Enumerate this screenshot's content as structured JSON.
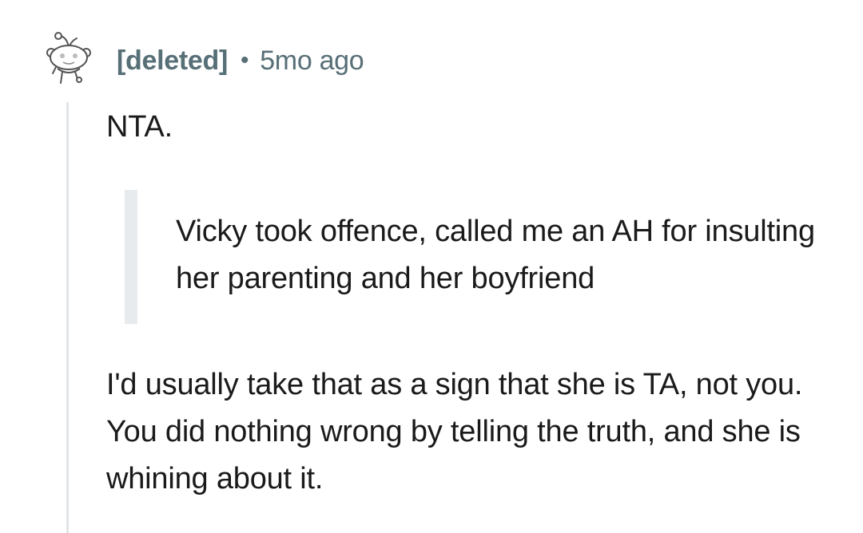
{
  "comment": {
    "author": "[deleted]",
    "separator": "•",
    "timestamp": "5mo ago",
    "avatar_icon": "snoo-avatar-icon",
    "paragraphs": {
      "first": "NTA.",
      "quote": "Vicky took offence, called me an AH for insulting her parenting and her boyfriend",
      "last": "I'd usually take that as a sign that she is TA, not you. You did nothing wrong by telling the truth, and she is whining about it."
    }
  },
  "colors": {
    "meta": "#576f76",
    "text": "#1a1a1b",
    "thread_line": "#e2e5e7",
    "quote_bar": "#e8ebed"
  }
}
